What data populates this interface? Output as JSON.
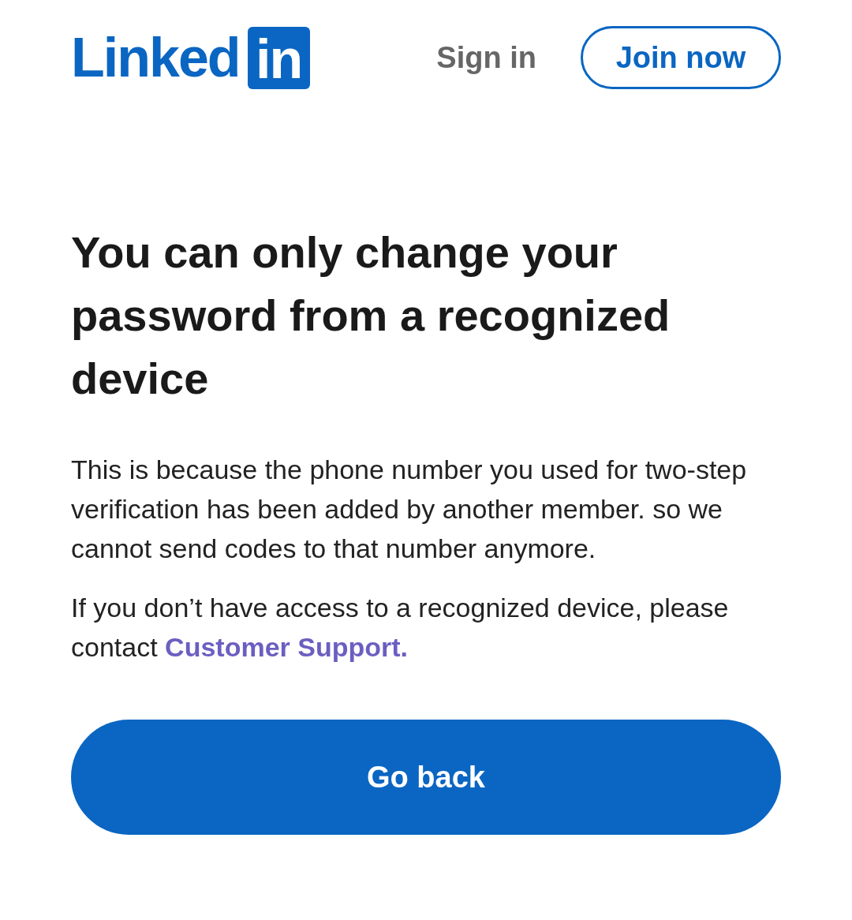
{
  "header": {
    "logo": {
      "wordmark": "Linked",
      "badge": "in"
    },
    "sign_in": "Sign in",
    "join_now": "Join now"
  },
  "notice": {
    "heading": "You can only change your password from a recognized device",
    "paragraphs": [
      {
        "text": "This is because the phone number you used for two-step verification has been added by another member. so we cannot send codes to that number anymore."
      },
      {
        "text": "If you don’t have access to a recognized device, please contact",
        "link": "Customer Support."
      }
    ]
  },
  "primary_button": "Go back"
}
